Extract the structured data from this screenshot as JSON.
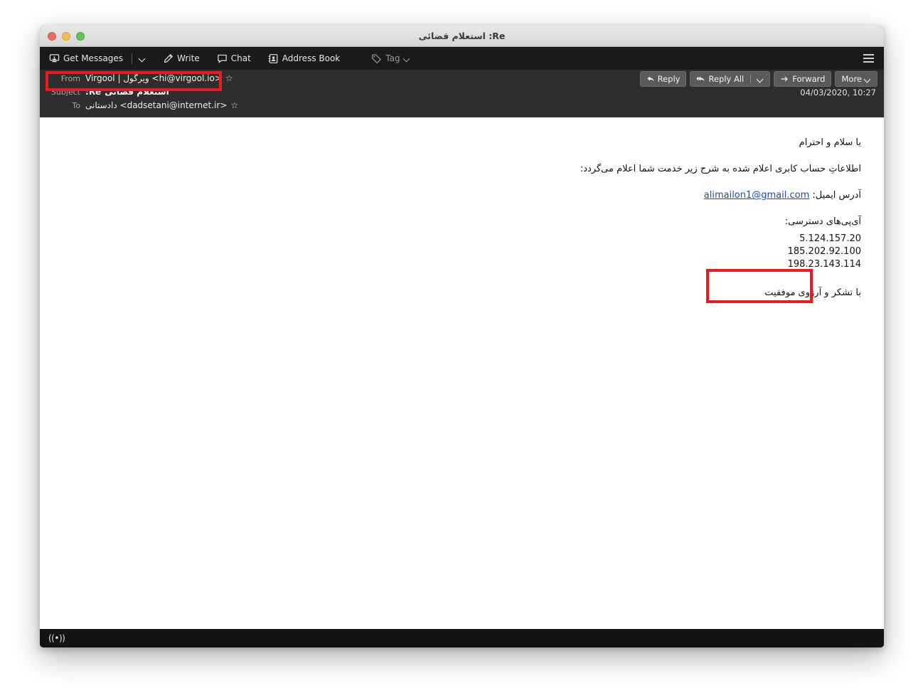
{
  "window": {
    "title": "Re: استعلام قضائی",
    "traffic_lights": [
      "close",
      "minimize",
      "zoom"
    ]
  },
  "toolbar": {
    "get_messages_label": "Get Messages",
    "get_messages_icon": "inbox-download-icon",
    "write_label": "Write",
    "write_icon": "pencil-icon",
    "chat_label": "Chat",
    "chat_icon": "speech-bubble-icon",
    "address_book_label": "Address Book",
    "address_book_icon": "address-book-icon",
    "tag_label": "Tag",
    "tag_icon": "tag-icon",
    "menu_icon": "hamburger-menu-icon",
    "dropdown_icon": "chevron-down-icon"
  },
  "headers": {
    "from_label": "From",
    "from_value": "Virgool | ویرگول <hi@virgool.io>",
    "from_star_icon": "star-icon",
    "subject_label": "Subject",
    "subject_prefix": "Re:",
    "subject_value": "استعلام قضائی",
    "to_label": "To",
    "to_value": "دادستانی <dadsetani@internet.ir>",
    "to_star_icon": "star-icon",
    "timestamp": "04/03/2020, 10:27"
  },
  "actions": {
    "reply_label": "Reply",
    "reply_icon": "reply-arrow-icon",
    "reply_all_label": "Reply All",
    "reply_all_icon": "reply-all-arrow-icon",
    "forward_label": "Forward",
    "forward_icon": "forward-arrow-icon",
    "more_label": "More",
    "more_icon": "chevron-down-icon"
  },
  "message": {
    "greeting": "با سلام و احترام",
    "intro": "اطلاعاتِ حساب کابری اعلام شده به شرح زیر خدمت شما اعلام می‌گردد:",
    "email_label": "آدرس ایمیل:",
    "email_value": "alimailon1@gmail.com",
    "ip_heading": "آی‌پی‌های دسترسی:",
    "ip_addresses": [
      "5.124.157.20",
      "185.202.92.100",
      "198.23.143.114"
    ],
    "closing": "با تشکر و آرزوی موفقیت"
  },
  "statusbar": {
    "rss_icon": "broadcast-signal-icon",
    "rss_glyph": "((•))"
  },
  "annotations": {
    "highlight_color": "#e81b23",
    "boxes": [
      {
        "name": "from-field-highlight",
        "target": "from-row"
      },
      {
        "name": "closing-text-highlight",
        "target": "closing-line"
      }
    ]
  }
}
